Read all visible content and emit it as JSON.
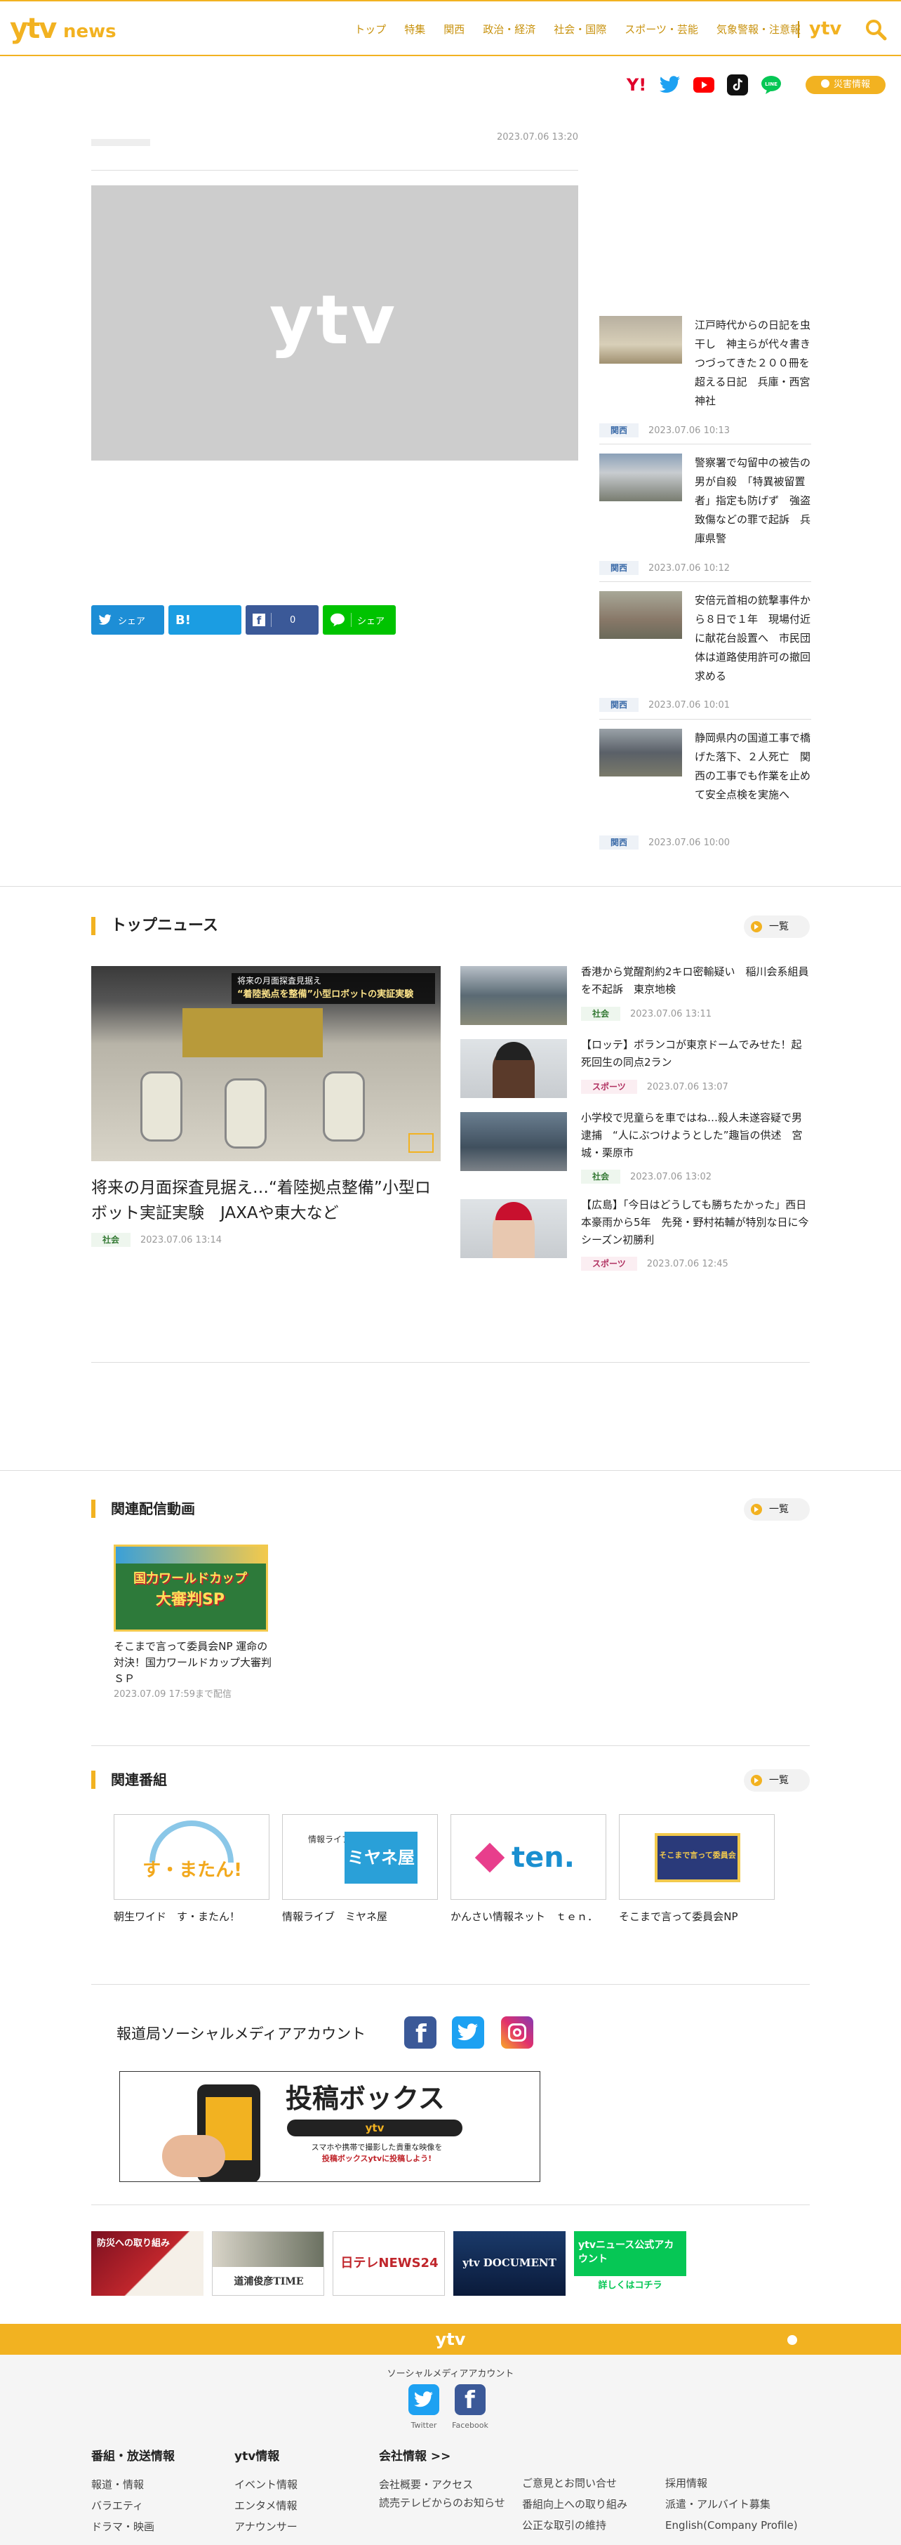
{
  "header": {
    "logo_ytv": "ytv",
    "logo_news": "news",
    "nav": [
      "トップ",
      "特集",
      "関西",
      "政治・経済",
      "社会・国際",
      "スポーツ・芸能",
      "気象警報・注意報"
    ],
    "brand": "ytv",
    "disaster_label": "災害情報",
    "accent_color": "#f2b221"
  },
  "article": {
    "date": "2023.07.06 13:20",
    "image_placeholder": "ytv",
    "share": {
      "twitter": "シェア",
      "hatena": "",
      "facebook_count": "0",
      "line": "シェア"
    }
  },
  "sidebar": [
    {
      "title": "江戸時代からの日記を虫干し　神主らが代々書きつづってきた２００冊を超える日記　兵庫・西宮神社",
      "tag": "関西",
      "date": "2023.07.06 10:13"
    },
    {
      "title": "警察署で勾留中の被告の男が自殺　「特異被留置者」指定も防げず　強盗致傷などの罪で起訴　兵庫県警",
      "tag": "関西",
      "date": "2023.07.06 10:12"
    },
    {
      "title": "安倍元首相の銃撃事件から８日で１年　現場付近に献花台設置へ　市民団体は道路使用許可の撤回求める",
      "tag": "関西",
      "date": "2023.07.06 10:01"
    },
    {
      "title": "静岡県内の国道工事で橋げた落下、２人死亡　関西の工事でも作業を止めて安全点検を実施へ",
      "tag": "関西",
      "date": "2023.07.06 10:00"
    }
  ],
  "top_news": {
    "heading": "トップニュース",
    "more": "一覧",
    "main": {
      "caption_line1": "将来の月面探査見据え",
      "caption_line2": "“着陸拠点を整備”小型ロボットの実証実験",
      "title": "将来の月面探査見据え…“着陸拠点整備”小型ロボット実証実験　JAXAや東大など",
      "tag": "社会",
      "date": "2023.07.06 13:14"
    },
    "items": [
      {
        "title": "香港から覚醒剤約2キロ密輸疑い　稲川会系組員を不起訴　東京地検",
        "tag": "社会",
        "tag_class": "shakai",
        "date": "2023.07.06 13:11"
      },
      {
        "title": "【ロッテ】ポランコが東京ドームでみせた！起死回生の同点2ラン",
        "tag": "スポーツ",
        "tag_class": "sports",
        "date": "2023.07.06 13:07"
      },
      {
        "title": "小学校で児童らを車ではね…殺人未遂容疑で男逮捕　“人にぶつけようとした”趣旨の供述　宮城・栗原市",
        "tag": "社会",
        "tag_class": "shakai",
        "date": "2023.07.06 13:02"
      },
      {
        "title": "【広島】「今日はどうしても勝ちたかった」西日本豪雨から5年　先発・野村祐輔が特別な日に今シーズン初勝利",
        "tag": "スポーツ",
        "tag_class": "sports",
        "date": "2023.07.06 12:45"
      }
    ]
  },
  "videos": {
    "heading": "関連配信動画",
    "more": "一覧",
    "items": [
      {
        "thumb_text_1": "国力ワールドカップ",
        "thumb_text_2": "大審判SP",
        "title": "そこまで言って委員会NP 運命の対決！国力ワールドカップ大審判ＳＰ",
        "date": "2023.07.09 17:59まで配信"
      }
    ]
  },
  "programs": {
    "heading": "関連番組",
    "more": "一覧",
    "items": [
      {
        "name": "朝生ワイド　す・またん！",
        "logo": "す・またん!"
      },
      {
        "name": "情報ライブ　ミヤネ屋",
        "logo": "ミヤネ屋",
        "logo_sub": "情報ライブ"
      },
      {
        "name": "かんさい情報ネット　ｔｅｎ．",
        "logo": "ten."
      },
      {
        "name": "そこまで言って委員会NP",
        "logo": "そこまで言って委員会"
      }
    ]
  },
  "sns": {
    "title": "報道局ソーシャルメディアアカウント",
    "tokou_title": "投稿ボックス",
    "tokou_brand": "ytv",
    "tokou_line1": "スマホや携帯で撮影した貴重な映像を",
    "tokou_line2": "投稿ボックスytvに投稿しよう!"
  },
  "banners": [
    {
      "text": "防災への取り組み"
    },
    {
      "text": "道浦俊彦TIME"
    },
    {
      "text": "日テレNEWS24"
    },
    {
      "text": "ytv DOCUMENT"
    },
    {
      "text": "ytvニュース公式アカウント",
      "sub": "詳しくはコチラ"
    }
  ],
  "footer": {
    "brand": "ytv",
    "sns_label": "ソーシャルメディアアカウント",
    "twitter_label": "Twitter",
    "facebook_label": "Facebook",
    "cols": [
      {
        "heading": "番組・放送情報",
        "links": [
          "報道・情報",
          "バラエティ",
          "ドラマ・映画"
        ]
      },
      {
        "heading": "ytv情報",
        "links": [
          "イベント情報",
          "エンタメ情報",
          "アナウンサー"
        ]
      },
      {
        "heading": "会社情報 >>",
        "links": [
          "会社概要・アクセス",
          "読売テレビからのお知らせ"
        ]
      },
      {
        "heading": "",
        "links": [
          "ご意見とお問い合せ",
          "番組向上への取り組み",
          "公正な取引の維持"
        ]
      },
      {
        "heading": "",
        "links": [
          "採用情報",
          "派遣・アルバイト募集",
          "English(Company Profile)"
        ]
      }
    ]
  }
}
